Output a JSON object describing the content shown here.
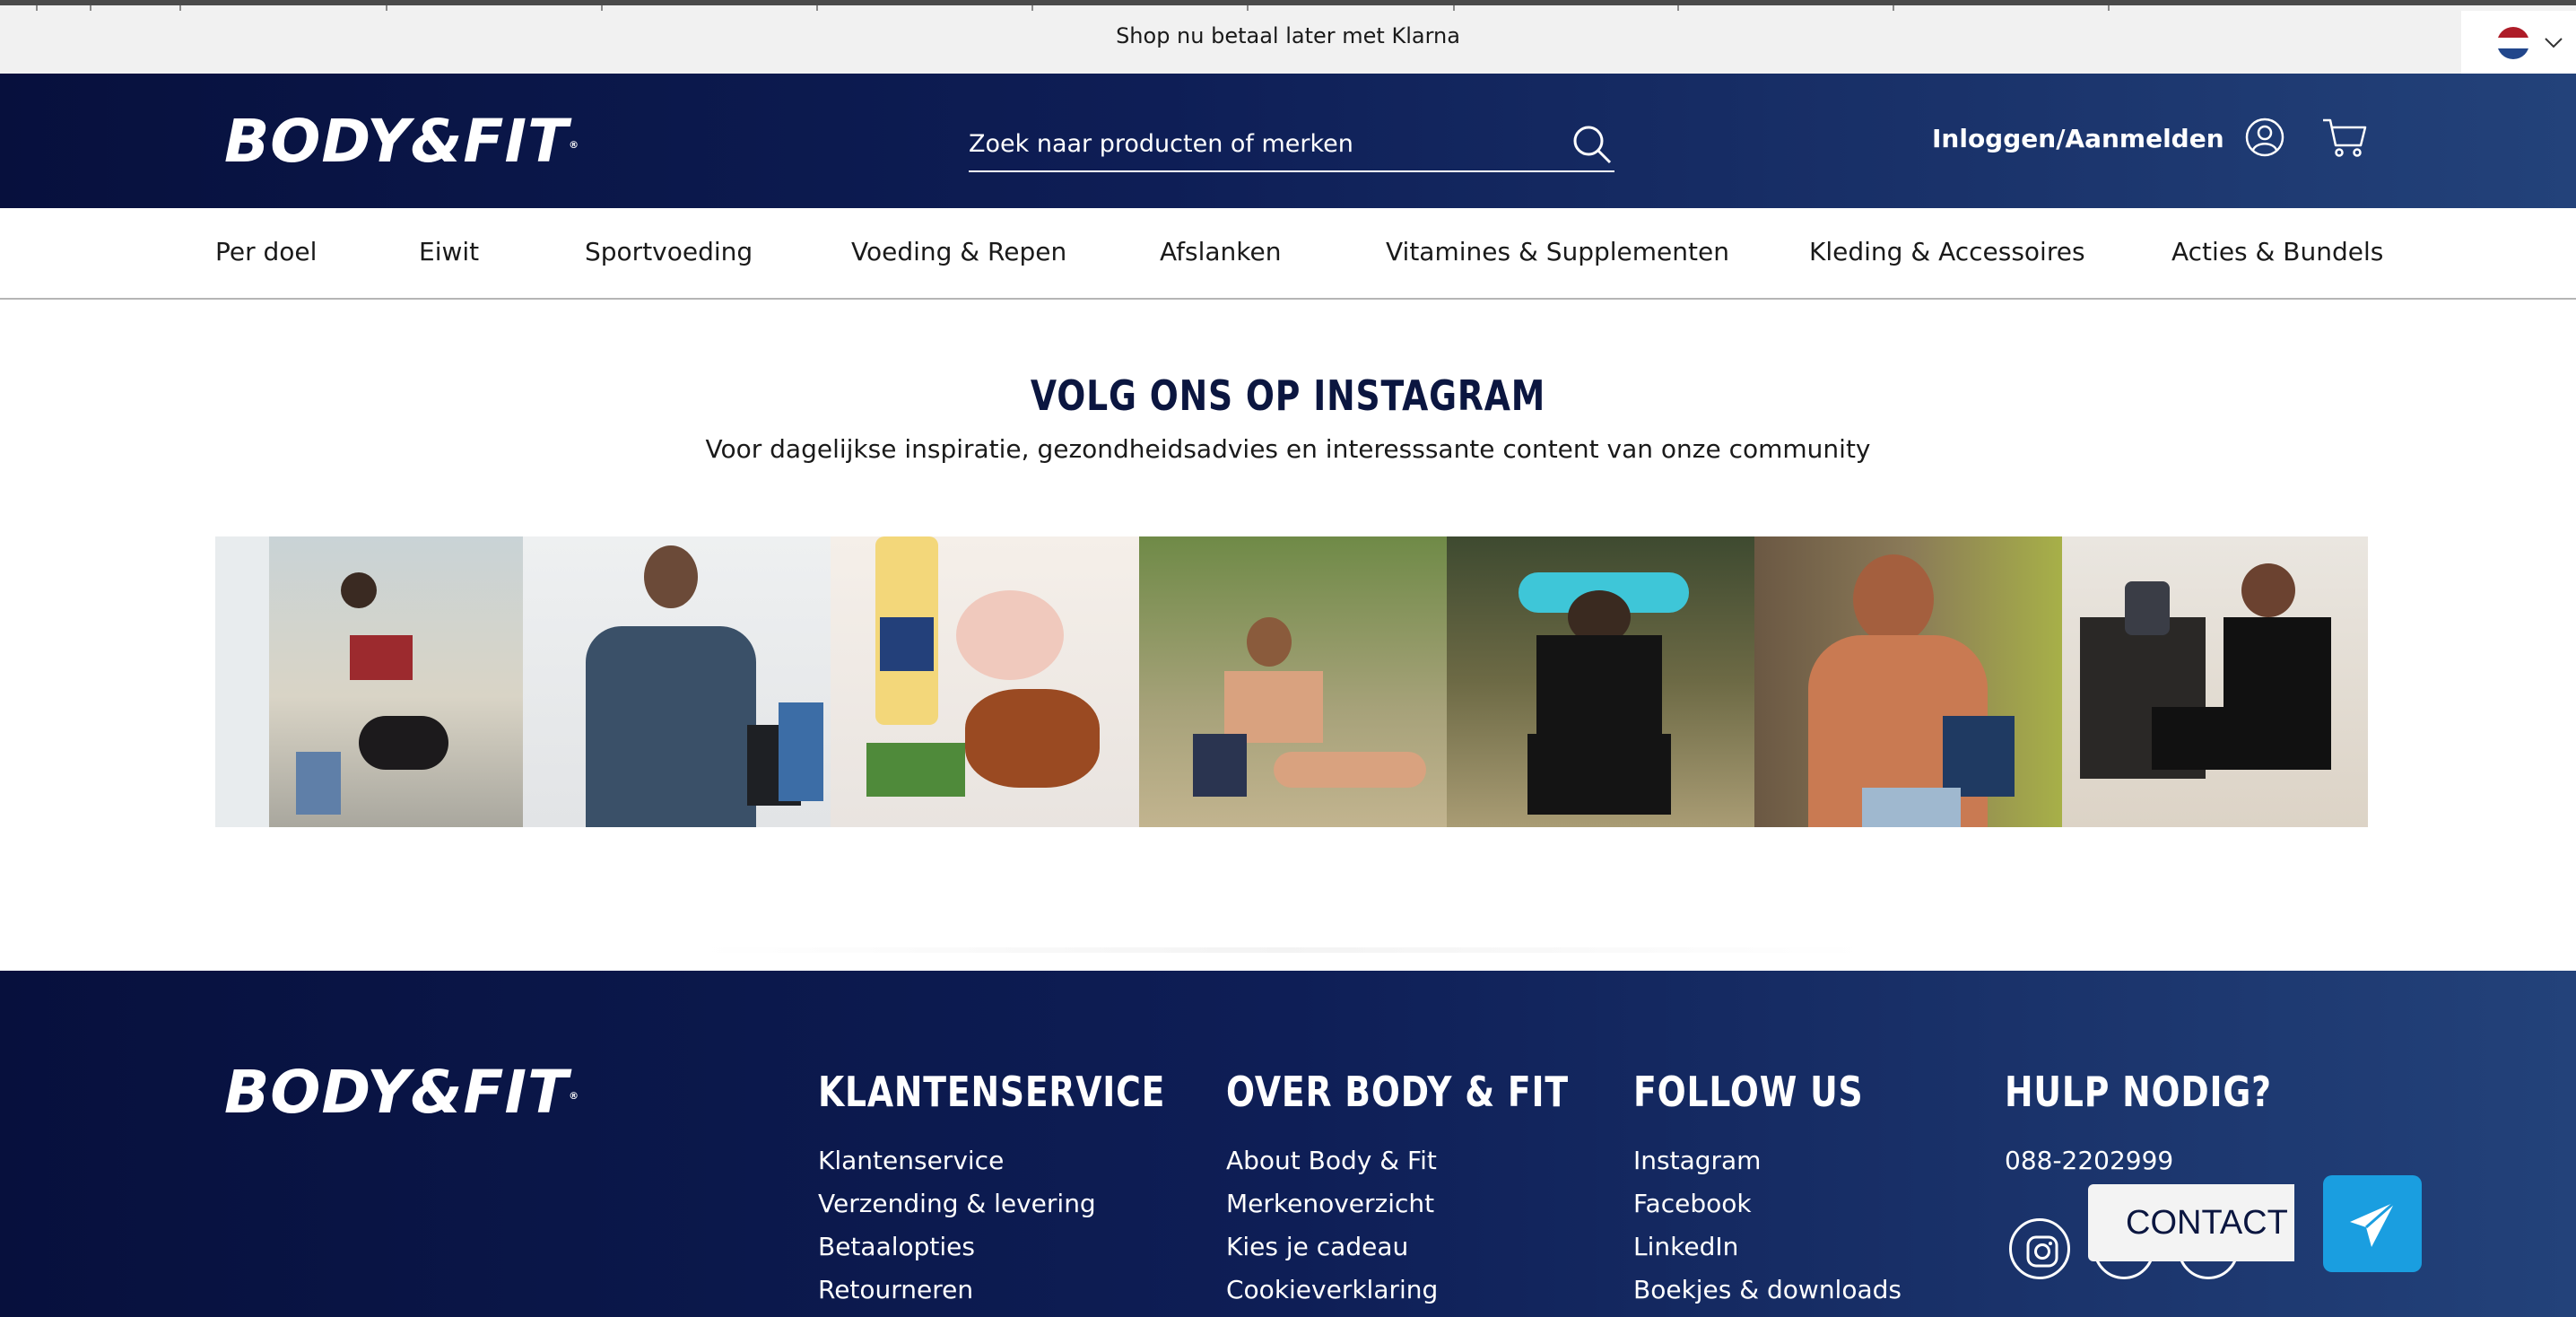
{
  "topbar": {
    "announcement": "Shop nu betaal later met Klarna",
    "language_flag": "netherlands-flag"
  },
  "header": {
    "logo": "BODY&FIT",
    "search_placeholder": "Zoek naar producten of merken",
    "login_label": "Inloggen/Aanmelden"
  },
  "nav": {
    "items": [
      {
        "label": "Per doel"
      },
      {
        "label": "Eiwit"
      },
      {
        "label": "Sportvoeding"
      },
      {
        "label": "Voeding & Repen"
      },
      {
        "label": "Afslanken"
      },
      {
        "label": "Vitamines & Supplementen"
      },
      {
        "label": "Kleding & Accessoires"
      },
      {
        "label": "Acties & Bundels"
      }
    ]
  },
  "instagram": {
    "title": "VOLG ONS OP INSTAGRAM",
    "subtitle": "Voor dagelijkse inspiratie, gezondheidsadvies en interesssante content van onze community"
  },
  "footer": {
    "logo": "BODY&FIT",
    "columns": [
      {
        "title": "KLANTENSERVICE",
        "links": [
          "Klantenservice",
          "Verzending & levering",
          "Betaalopties",
          "Retourneren"
        ]
      },
      {
        "title": "OVER BODY & FIT",
        "links": [
          "About Body & Fit",
          "Merkenoverzicht",
          "Kies je cadeau",
          "Cookieverklaring"
        ]
      },
      {
        "title": "FOLLOW US",
        "links": [
          "Instagram",
          "Facebook",
          "LinkedIn",
          "Boekjes & downloads"
        ]
      },
      {
        "title": "HULP NODIG?",
        "links": [
          "088-2202999"
        ]
      }
    ]
  },
  "contact": {
    "label": "CONTACT"
  },
  "colors": {
    "brand_navy": "#07103d",
    "brand_blue": "#23427a",
    "contact_blue": "#1a9ee0"
  }
}
